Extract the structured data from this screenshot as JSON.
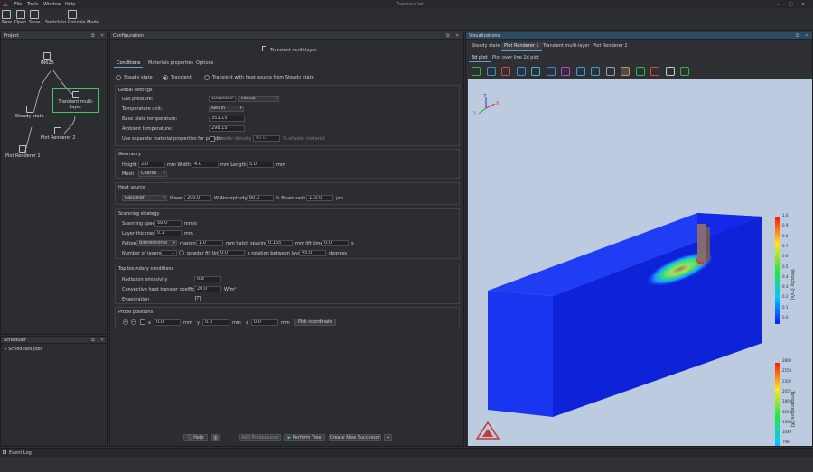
{
  "app": {
    "title": "Thermo-Calc",
    "menu": [
      "File",
      "Tools",
      "Window",
      "Help"
    ]
  },
  "toolbar": [
    {
      "label": "New",
      "icon": "new-file-icon"
    },
    {
      "label": "Open",
      "icon": "folder-open-icon"
    },
    {
      "label": "Save",
      "icon": "save-icon"
    },
    {
      "label": "Switch to Console Mode",
      "icon": "console-mode-icon"
    }
  ],
  "project": {
    "title": "Project",
    "nodes": [
      {
        "label": "IN625",
        "icon": "folder-icon"
      },
      {
        "label": "Transient multi-layer",
        "icon": "calculator-icon"
      },
      {
        "label": "Steady state",
        "icon": "calculator-icon"
      },
      {
        "label": "Plot Renderer 2",
        "icon": "chart-icon"
      },
      {
        "label": "Plot Renderer 1",
        "icon": "chart-icon"
      }
    ]
  },
  "scheduler": {
    "title": "Scheduler",
    "item": "Scheduled Jobs"
  },
  "config": {
    "title": "Configuration",
    "calc_title": "Transient multi-layer",
    "tabs": [
      "Conditions",
      "Materials properties",
      "Options"
    ],
    "modes": [
      "Steady state",
      "Transient",
      "Transient with heat source from Steady state"
    ],
    "global": {
      "title": "Global settings",
      "gas_pressure_label": "Gas pressure:",
      "gas_pressure": "100000.0",
      "gas_pressure_unit": "Pascal",
      "temp_unit_label": "Temperature unit:",
      "temp_unit": "Kelvin",
      "base_plate_label": "Base plate temperature:",
      "base_plate": "353.15",
      "ambient_label": "Ambient temperature:",
      "ambient": "298.15",
      "powder_label": "Use separate material properties for powder",
      "powder_density_label": "Powder density",
      "powder_density": "80.0",
      "powder_density_unit": "% of solid material"
    },
    "geometry": {
      "title": "Geometry",
      "height_label": "Height",
      "height": "2.0",
      "width_label": "mm Width",
      "width": "4.0",
      "length_label": "mm Length",
      "length": "5.0",
      "length_unit": "mm",
      "mesh_label": "Mesh",
      "mesh": "Coarse"
    },
    "heat": {
      "title": "Heat source",
      "type": "Gaussian",
      "power_label": "Power",
      "power": "200.0",
      "absorptivity_label": "W Absorptivity",
      "absorptivity": "60.0",
      "beam_label": "% Beam radius",
      "beam": "110.0",
      "beam_unit": "µm"
    },
    "scan": {
      "title": "Scanning strategy",
      "speed_label": "Scanning speed",
      "speed": "50.0",
      "speed_unit": "mm/s",
      "layer_label": "Layer thickness",
      "layer": "0.1",
      "layer_unit": "mm",
      "pattern_label": "Pattern",
      "pattern": "Bidirectional",
      "margin_label": "margin",
      "margin": "1.0",
      "hatch_label": "mm hatch spacing",
      "hatch": "0.165",
      "lift_label": "mm lift time",
      "lift": "0.0",
      "lift_unit": "s",
      "layers_label": "Number of layers",
      "layers": "1",
      "powder_fill_label": "powder fill time",
      "powder_fill": "0.0",
      "rotation_label": "s rotation between layers",
      "rotation": "45.0",
      "rotation_unit": "degrees"
    },
    "top": {
      "title": "Top boundary conditions",
      "emissivity_label": "Radiation emissivity",
      "emissivity": "0.8",
      "htc_label": "Convective heat transfer coefficient",
      "htc": "20.0",
      "htc_unit": "W/m²",
      "evap_label": "Evaporation"
    },
    "probe": {
      "title": "Probe positions",
      "x_label": "x",
      "x": "0.0",
      "x_unit": "mm",
      "y_label": "y",
      "y": "0.0",
      "y_unit": "mm",
      "z_label": "z",
      "z": "0.0",
      "z_unit": "mm",
      "pick_label": "Pick coordinate"
    },
    "buttons": {
      "help": "Help",
      "add_predecessor": "Add Predecessor",
      "perform_tree": "Perform Tree",
      "create_successor": "Create New Successor"
    }
  },
  "viz": {
    "title": "Visualizations",
    "tabs": [
      "Steady state",
      "Plot Renderer 1",
      "Transient multi-layer",
      "Plot Renderer 2"
    ],
    "subtabs": [
      "3d plot",
      "Plot over line 2d plot"
    ],
    "icons": [
      "reset-view-icon",
      "orthogonal-icon",
      "rotate-x-icon",
      "rotate-y-icon",
      "rotate-z-icon",
      "axis-icon",
      "color-icon",
      "rescale-icon",
      "grid-icon",
      "ruler-icon",
      "slice-icon",
      "cube-icon",
      "cup-icon",
      "toggle-view-icon",
      "export-icon"
    ],
    "axes": {
      "x": "X",
      "y": "Y",
      "z": "Z"
    },
    "colorbar1": {
      "title": "Velocity (m/s)",
      "ticks": [
        "1.0",
        "0.9",
        "0.8",
        "0.7",
        "0.6",
        "0.5",
        "0.4",
        "0.3",
        "0.2",
        "0.1",
        "0.0"
      ]
    },
    "colorbar2": {
      "title": "Temperature (K)",
      "ticks": [
        "2804",
        "2553",
        "2302",
        "2052",
        "1801",
        "1550",
        "1300",
        "1049",
        "798",
        "548",
        "297"
      ]
    },
    "colors": {
      "low": "#0a1fff",
      "high": "#ff1a0a"
    }
  },
  "status": {
    "event_log": "Event Log"
  }
}
